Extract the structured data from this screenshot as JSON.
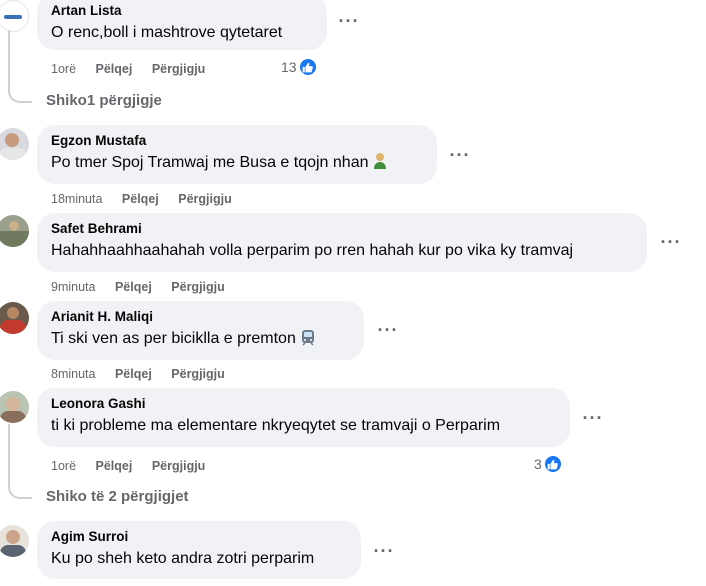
{
  "comments": [
    {
      "author": "Artan Lista",
      "text": "O renc,boll i mashtrove qytetaret",
      "time": "1orë",
      "like_label": "Pëlqej",
      "reply_label": "Përgjigju",
      "reaction_count": "13"
    },
    {
      "author": "Egzon Mustafa",
      "text": "Po tmer Spoj Tramwaj me Busa e tqojn nhan",
      "time": "18minuta",
      "like_label": "Pëlqej",
      "reply_label": "Përgjigju"
    },
    {
      "author": "Safet Behrami",
      "text": "Hahahhaahhaahahah volla perparim po rren hahah kur po vika ky tramvaj",
      "time": "9minuta",
      "like_label": "Pëlqej",
      "reply_label": "Përgjigju"
    },
    {
      "author": "Arianit H. Maliqi",
      "text": "Ti ski ven as per biciklla e premton",
      "time": "8minuta",
      "like_label": "Pëlqej",
      "reply_label": "Përgjigju"
    },
    {
      "author": "Leonora Gashi",
      "text": "ti ki probleme ma elementare nkryeqytet se tramvaji o Perparim",
      "time": "1orë",
      "like_label": "Pëlqej",
      "reply_label": "Përgjigju",
      "reaction_count": "3"
    },
    {
      "author": "Agim Surroi",
      "text": "Ku po sheh keto andra zotri perparim"
    }
  ],
  "view_replies_1": "Shiko1 përgjigje",
  "view_replies_2": "Shiko të 2 përgjigjet",
  "more_glyph": "···",
  "colors": {
    "bubble": "#f0f2f5",
    "meta_text": "#65676b",
    "like_blue": "#1877f2",
    "thread_line": "#ced0d4"
  },
  "icons": [
    "like-icon",
    "more-options-icon",
    "person-emoji-icon",
    "tram-emoji-icon"
  ]
}
